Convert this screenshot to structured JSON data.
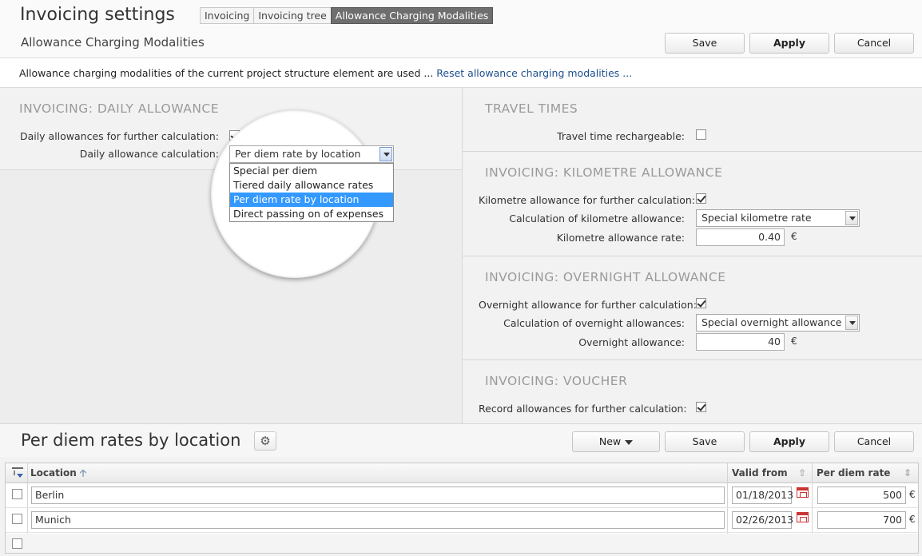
{
  "header": {
    "title": "Invoicing settings",
    "subtitle": "Allowance Charging Modalities",
    "tabs": [
      {
        "label": "Invoicing"
      },
      {
        "label": "Invoicing tree"
      },
      {
        "label": "Allowance Charging Modalities"
      }
    ],
    "save_label": "Save",
    "apply_label": "Apply",
    "cancel_label": "Cancel"
  },
  "info": {
    "text": "Allowance charging modalities of the current project structure element are used ... ",
    "link": "Reset allowance charging modalities ..."
  },
  "daily": {
    "title": "INVOICING: DAILY ALLOWANCE",
    "further_label": "Daily allowances for further calculation:",
    "calc_label": "Daily allowance calculation:",
    "calc_value": "Per diem rate by location",
    "options": [
      "Special per diem",
      "Tiered daily allowance rates",
      "Per diem rate by location",
      "Direct passing on of expenses"
    ]
  },
  "travel": {
    "title": "TRAVEL TIMES",
    "rechargeable_label": "Travel time rechargeable:"
  },
  "km": {
    "title": "INVOICING: KILOMETRE ALLOWANCE",
    "further_label": "Kilometre allowance for further calculation:",
    "calc_label": "Calculation of kilometre allowance:",
    "calc_value": "Special kilometre rate",
    "rate_label": "Kilometre allowance rate:",
    "rate_value": "0.40",
    "unit": "€"
  },
  "overnight": {
    "title": "INVOICING: OVERNIGHT ALLOWANCE",
    "further_label": "Overnight allowance for further calculation:",
    "calc_label": "Calculation of overnight allowances:",
    "calc_value": "Special overnight allowance",
    "amount_label": "Overnight allowance:",
    "amount_value": "40",
    "unit": "€"
  },
  "voucher": {
    "title": "INVOICING: VOUCHER",
    "record_label": "Record allowances for further calculation:"
  },
  "lower": {
    "title": "Per diem rates by location",
    "new_label": "New",
    "save_label": "Save",
    "apply_label": "Apply",
    "cancel_label": "Cancel"
  },
  "grid": {
    "columns": {
      "location": "Location",
      "valid_from": "Valid from",
      "per_diem_rate": "Per diem rate"
    },
    "rows": [
      {
        "location": "Berlin",
        "valid_from": "01/18/2013",
        "rate": "500",
        "unit": "€"
      },
      {
        "location": "Munich",
        "valid_from": "02/26/2013",
        "rate": "700",
        "unit": "€"
      }
    ]
  },
  "colors": {
    "accent": "#3399ff",
    "link": "#1e4f8f",
    "active_tab": "#6e6e6e"
  }
}
